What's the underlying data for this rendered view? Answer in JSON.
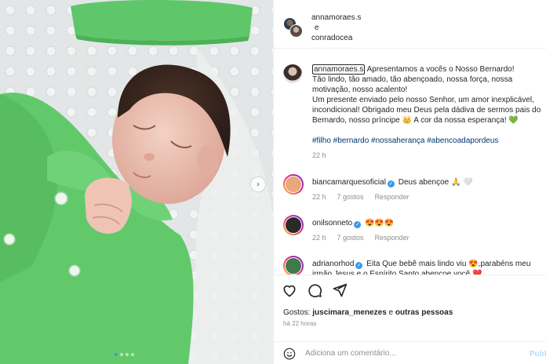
{
  "header": {
    "user1": "annamoraes.s",
    "and": "e",
    "user2": "conradocea"
  },
  "caption": {
    "username": "annamoraes.s",
    "text": " Apresentamos a vocês o Nosso Bernardo!\nTão lindo, tão amado, tão abençoado, nossa força, nossa motivação, nosso acalento!\nUm presente enviado pelo nosso Senhor, um amor inexplicável, incondicional! Obrigado meu Deus pela dádiva de sermos pais do Bernardo, nosso príncipe 👑 A cor da nossa esperança! 💚",
    "hashtags": "#filho #bernardo #nossaherança #abencoadapordeus",
    "time": "22 h"
  },
  "comments": [
    {
      "username": "biancamarquesoficial",
      "text": "Deus abençoe 🙏 🤍",
      "time": "22 h",
      "likes": "7 gostos",
      "reply": "Responder",
      "avatar_color": "#e8a87c"
    },
    {
      "username": "onilsonneto",
      "text": "😍😍😍",
      "time": "22 h",
      "likes": "7 gostos",
      "reply": "Responder",
      "avatar_color": "#2a2a2a"
    },
    {
      "username": "adrianorhod",
      "text": "Eita Que bebê mais lindo viu 😍,parabéns meu irmão Jesus e o Espírito Santo abençoe você ❤️",
      "time": "",
      "likes": "",
      "reply": "",
      "avatar_color": "#3f7a4a"
    }
  ],
  "likes": {
    "prefix": "Gostos: ",
    "user": "juscimara_menezes",
    "middle": " e ",
    "others": "outras pessoas"
  },
  "time_ago": "há 22 horas",
  "add_comment": {
    "placeholder": "Adiciona um comentário...",
    "publish": "Publicar"
  },
  "icons": {
    "like": "heart-icon",
    "comment": "comment-icon",
    "share": "share-icon",
    "emoji": "smile-icon",
    "next": "chevron-right-icon"
  },
  "colors": {
    "link": "#00376b",
    "verified": "#3897f0",
    "muted": "#8e8e8e",
    "onesie": "#66cc66"
  }
}
